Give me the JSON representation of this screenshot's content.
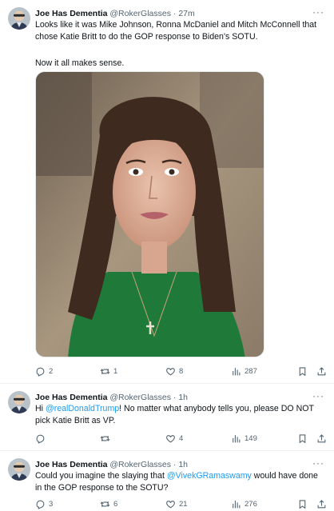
{
  "tweets": [
    {
      "name": "Joe Has Dementia",
      "handle": "@RokerGlasses",
      "dot": "·",
      "time": "27m",
      "text_lines": [
        "Looks like it was Mike Johnson, Ronna McDaniel and Mitch McConnell that",
        "chose Katie Britt to do the GOP response to Biden's SOTU.",
        "",
        "Now it all makes sense."
      ],
      "replies": "2",
      "retweets": "1",
      "likes": "8",
      "views": "287"
    },
    {
      "name": "Joe Has Dementia",
      "handle": "@RokerGlasses",
      "dot": "·",
      "time": "1h",
      "text_before": "Hi ",
      "mention": "@realDonaldTrump",
      "text_after": "! No matter what anybody tells you, please DO NOT",
      "text_line2": "pick Katie Britt as VP.",
      "replies": "",
      "retweets": "",
      "likes": "4",
      "views": "149"
    },
    {
      "name": "Joe Has Dementia",
      "handle": "@RokerGlasses",
      "dot": "·",
      "time": "1h",
      "text_before": "Could you imagine the slaying that ",
      "mention": "@VivekGRamaswamy",
      "text_after": " would have done",
      "text_line2": "in the GOP response to the SOTU?",
      "replies": "3",
      "retweets": "6",
      "likes": "21",
      "views": "276"
    }
  ],
  "more_label": "···",
  "icons": [
    "reply-icon",
    "retweet-icon",
    "like-icon",
    "views-icon",
    "bookmark-icon",
    "share-icon"
  ],
  "colors": {
    "accent": "#1d9bf0",
    "muted": "#536471",
    "text": "#0f1419"
  }
}
